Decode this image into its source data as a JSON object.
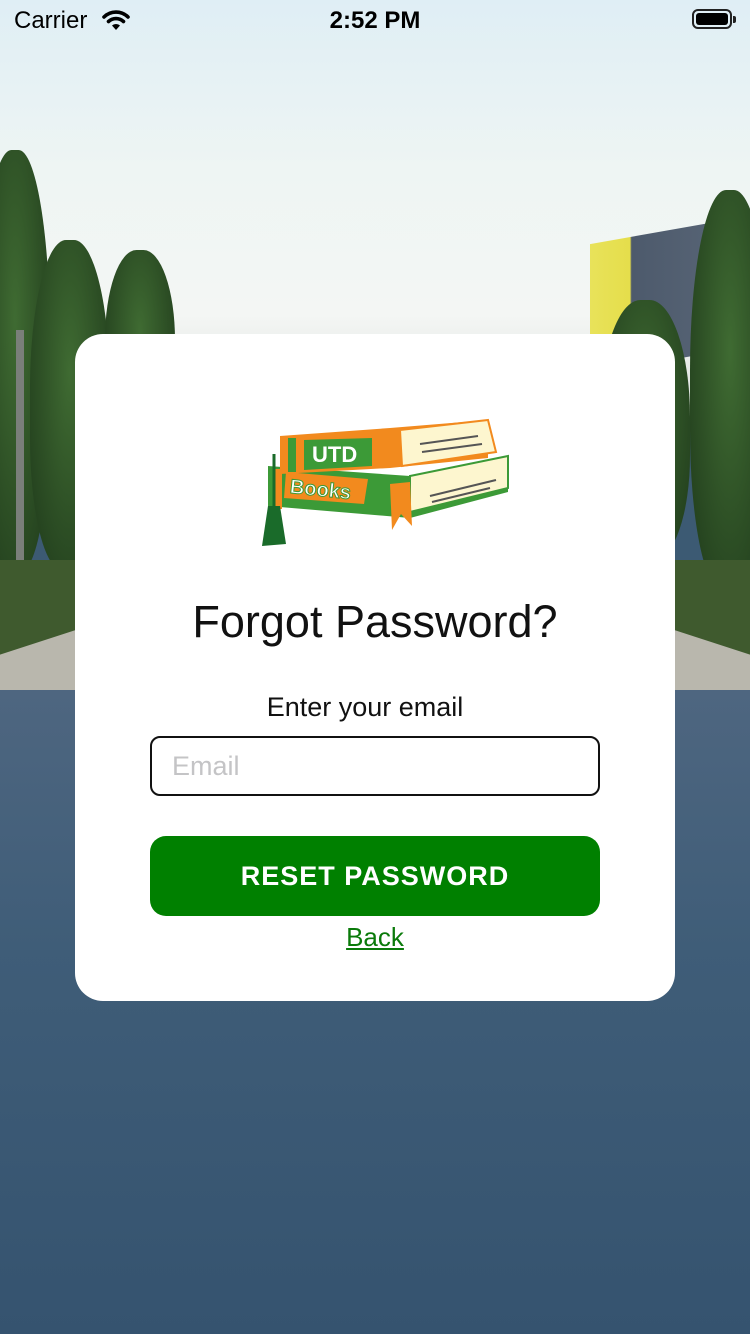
{
  "status_bar": {
    "carrier": "Carrier",
    "time": "2:52 PM"
  },
  "logo": {
    "top_book_label": "UTD",
    "bottom_book_label": "Books",
    "colors": {
      "orange": "#f28a1e",
      "green": "#3c9a37",
      "pages": "#fdf6cf"
    }
  },
  "forgot": {
    "title": "Forgot Password?",
    "instruction": "Enter your email",
    "email_placeholder": "Email",
    "email_value": "",
    "reset_label": "RESET PASSWORD",
    "back_label": "Back"
  },
  "colors": {
    "primary": "#008000",
    "link": "#0a7a0a",
    "card": "#ffffff"
  }
}
